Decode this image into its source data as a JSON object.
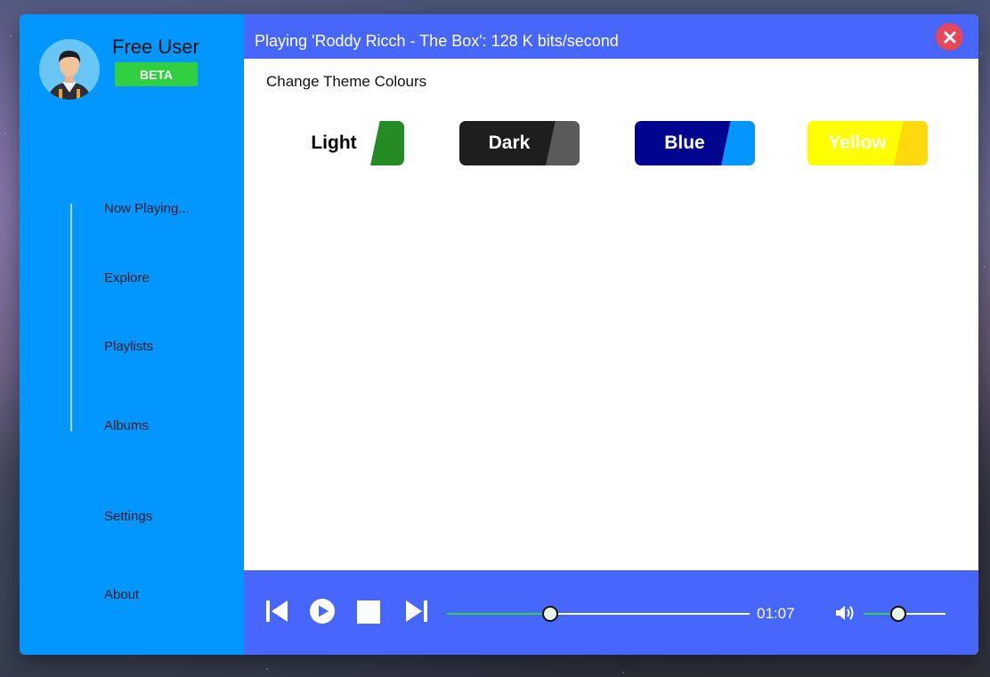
{
  "user": {
    "name": "Free User",
    "badge": "BETA"
  },
  "nav": {
    "items": [
      {
        "label": "Now Playing...",
        "icon": "none"
      },
      {
        "label": "Explore",
        "icon": "none"
      },
      {
        "label": "Playlists",
        "icon": "none"
      },
      {
        "label": "Albums",
        "icon": "none"
      },
      {
        "label": "Settings",
        "icon": "none"
      },
      {
        "label": "About",
        "icon": "none"
      }
    ]
  },
  "titlebar": {
    "text": "Playing 'Roddy Ricch - The Box': 128 K bits/second",
    "close_icon": "close-icon"
  },
  "settings": {
    "heading": "Change Theme Colours",
    "themes": [
      {
        "label": "Light",
        "bg": "#ffffff",
        "text": "#000000",
        "accent": "#238a24"
      },
      {
        "label": "Dark",
        "bg": "#1e1e1e",
        "text": "#ffffff",
        "accent": "#5a5a5a"
      },
      {
        "label": "Blue",
        "bg": "#00058f",
        "text": "#ffffff",
        "accent": "#0396fc"
      },
      {
        "label": "Yellow",
        "bg": "#ffff00",
        "text": "#ffffff",
        "accent": "#fcd80c"
      }
    ]
  },
  "player": {
    "time": "01:07",
    "progress": 0.34,
    "volume": 0.42,
    "progress_color": "#2fd24a",
    "controls": [
      "previous-icon",
      "play-icon",
      "stop-icon",
      "next-icon",
      "volume-icon"
    ]
  },
  "colors": {
    "sidebar": "#0396fc",
    "accent": "#4766fb",
    "close": "#e2475a",
    "badge": "#2fcf40"
  }
}
